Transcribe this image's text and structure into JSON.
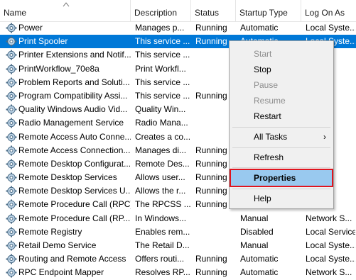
{
  "columns": {
    "name": "Name",
    "description": "Description",
    "status": "Status",
    "startup_type": "Startup Type",
    "log_on_as": "Log On As"
  },
  "rows": [
    {
      "name": "Power",
      "description": "Manages p...",
      "status": "Running",
      "startup": "Automatic",
      "logon": "Local Syste..."
    },
    {
      "name": "Print Spooler",
      "description": "This service ...",
      "status": "Running",
      "startup": "Automatic",
      "logon": "Local Syste...",
      "selected": true
    },
    {
      "name": "Printer Extensions and Notif...",
      "description": "This service ...",
      "status": "",
      "startup": "",
      "logon": ""
    },
    {
      "name": "PrintWorkflow_70e8a",
      "description": "Print Workfl...",
      "status": "",
      "startup": "",
      "logon": ""
    },
    {
      "name": "Problem Reports and Soluti...",
      "description": "This service ...",
      "status": "",
      "startup": "",
      "logon": ""
    },
    {
      "name": "Program Compatibility Assi...",
      "description": "This service ...",
      "status": "Running",
      "startup": "",
      "logon": ""
    },
    {
      "name": "Quality Windows Audio Vid...",
      "description": "Quality Win...",
      "status": "",
      "startup": "",
      "logon": ""
    },
    {
      "name": "Radio Management Service",
      "description": "Radio Mana...",
      "status": "",
      "startup": "",
      "logon": ""
    },
    {
      "name": "Remote Access Auto Conne...",
      "description": "Creates a co...",
      "status": "",
      "startup": "",
      "logon": ""
    },
    {
      "name": "Remote Access Connection...",
      "description": "Manages di...",
      "status": "Running",
      "startup": "",
      "logon": ""
    },
    {
      "name": "Remote Desktop Configurat...",
      "description": "Remote Des...",
      "status": "Running",
      "startup": "",
      "logon": ""
    },
    {
      "name": "Remote Desktop Services",
      "description": "Allows user...",
      "status": "Running",
      "startup": "",
      "logon": ""
    },
    {
      "name": "Remote Desktop Services U...",
      "description": "Allows the r...",
      "status": "Running",
      "startup": "",
      "logon": ""
    },
    {
      "name": "Remote Procedure Call (RPC)",
      "description": "The RPCSS ...",
      "status": "Running",
      "startup": "",
      "logon": ""
    },
    {
      "name": "Remote Procedure Call (RP...",
      "description": "In Windows...",
      "status": "",
      "startup": "Manual",
      "logon": "Network S..."
    },
    {
      "name": "Remote Registry",
      "description": "Enables rem...",
      "status": "",
      "startup": "Disabled",
      "logon": "Local Service"
    },
    {
      "name": "Retail Demo Service",
      "description": "The Retail D...",
      "status": "",
      "startup": "Manual",
      "logon": "Local Syste..."
    },
    {
      "name": "Routing and Remote Access",
      "description": "Offers routi...",
      "status": "Running",
      "startup": "Automatic",
      "logon": "Local Syste..."
    },
    {
      "name": "RPC Endpoint Mapper",
      "description": "Resolves RP...",
      "status": "Running",
      "startup": "Automatic",
      "logon": "Network S..."
    }
  ],
  "context_menu": {
    "start": "Start",
    "stop": "Stop",
    "pause": "Pause",
    "resume": "Resume",
    "restart": "Restart",
    "all_tasks": "All Tasks",
    "all_tasks_arrow": "›",
    "refresh": "Refresh",
    "properties": "Properties",
    "help": "Help"
  },
  "colors": {
    "selection": "#0078d7",
    "menu_highlight": "#99c9ef",
    "callout_border": "#e0141e"
  }
}
